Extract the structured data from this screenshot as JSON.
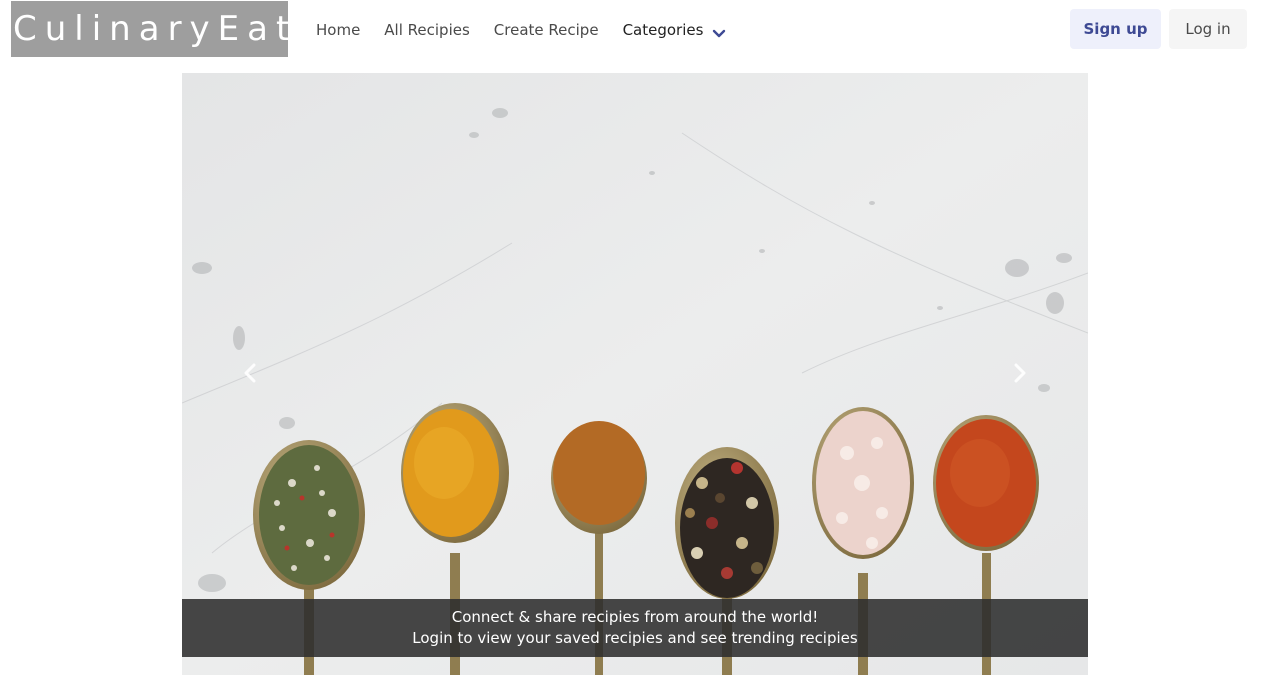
{
  "brand": {
    "name": "CulinaryEats"
  },
  "nav": {
    "home": "Home",
    "all_recipes": "All Recipies",
    "create_recipe": "Create Recipe",
    "categories": "Categories"
  },
  "auth": {
    "signup": "Sign up",
    "login": "Log in"
  },
  "carousel": {
    "caption_line1": "Connect & share recipies from around the world!",
    "caption_line2": "Login to view your saved recipies and see trending recipies"
  },
  "icons": {
    "categories_dropdown": "chevron-down-icon",
    "carousel_prev": "chevron-left-icon",
    "carousel_next": "chevron-right-icon"
  },
  "colors": {
    "brand_bg": "#9e9e9e",
    "signup_bg": "#eef0fb",
    "signup_text": "#3e4a94",
    "chevron": "#3e4a94",
    "caption_bg": "#2d2d2d"
  }
}
